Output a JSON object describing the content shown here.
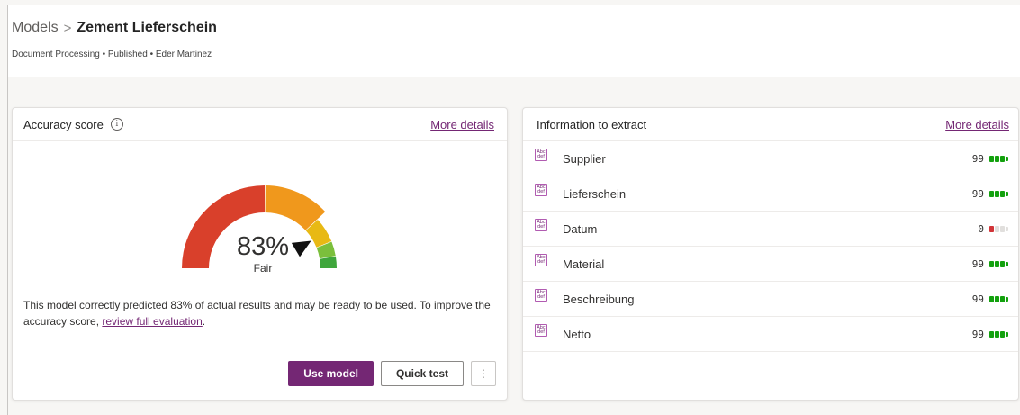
{
  "header": {
    "breadcrumb_root": "Models",
    "breadcrumb_separator": ">",
    "breadcrumb_current": "Zement Lieferschein",
    "subtitle": "Document Processing • Published • Eder Martinez"
  },
  "accuracy": {
    "title": "Accuracy score",
    "info_icon": "info-icon",
    "more_details": "More details",
    "score_value": 83,
    "score_text": "83%",
    "rating": "Fair",
    "description_prefix": "This model correctly predicted 83% of actual results and may be ready to be used. To improve the accuracy score, ",
    "description_link": "review full evaluation",
    "description_suffix": ".",
    "gauge_colors": {
      "poor": "#d9402b",
      "fair": "#f0981c",
      "good": "#e8b914",
      "very_good": "#7bbf3c",
      "excellent": "#3fa63c"
    },
    "use_model": "Use model",
    "quick_test": "Quick test",
    "more_icon": "more-vertical-icon"
  },
  "extract": {
    "title": "Information to extract",
    "more_details": "More details",
    "fields": [
      {
        "name": "Supplier",
        "score": "99",
        "level": "high"
      },
      {
        "name": "Lieferschein",
        "score": "99",
        "level": "high"
      },
      {
        "name": "Datum",
        "score": "0",
        "level": "low"
      },
      {
        "name": "Material",
        "score": "99",
        "level": "high"
      },
      {
        "name": "Beschreibung",
        "score": "99",
        "level": "high"
      },
      {
        "name": "Netto",
        "score": "99",
        "level": "high"
      }
    ],
    "field_icon_text": "Abc def",
    "colors": {
      "high": "#13a10e",
      "low": "#d13438",
      "empty": "#e1dfdd"
    }
  },
  "theme": {
    "accent": "#742774",
    "link": "#742774"
  }
}
